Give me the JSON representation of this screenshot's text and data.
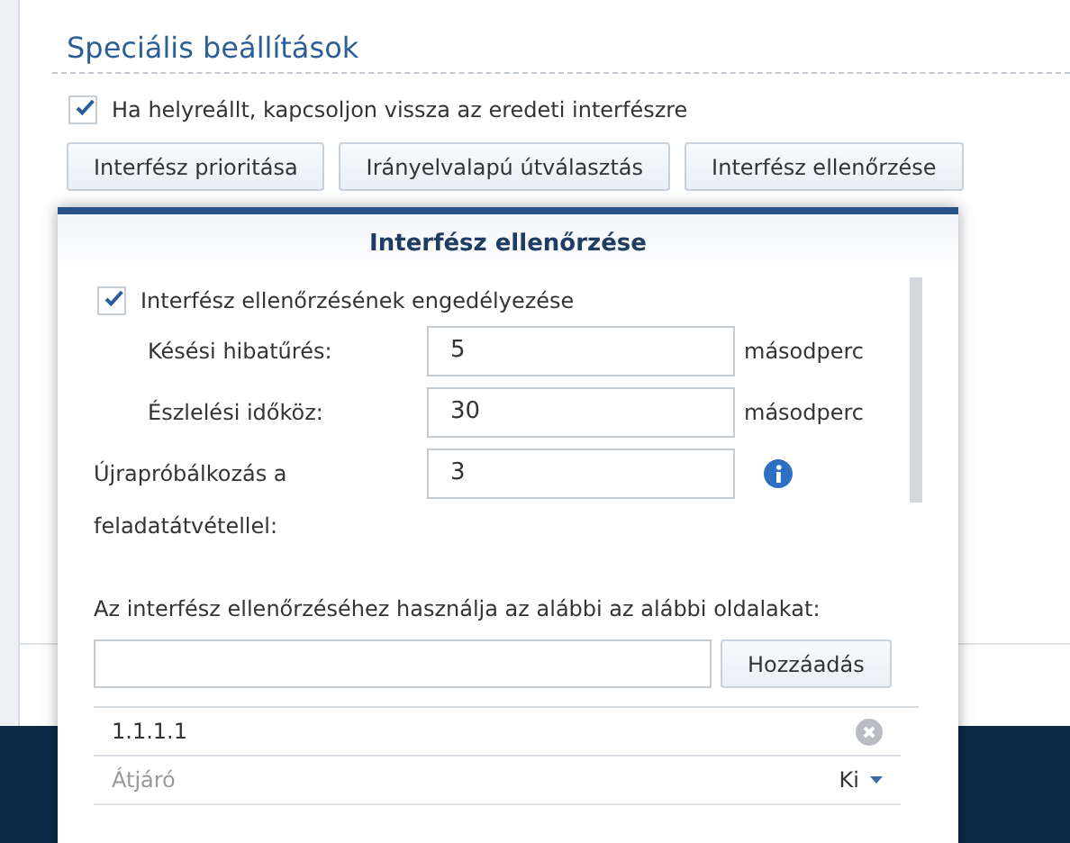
{
  "page": {
    "section_title": "Speciális beállítások",
    "revert_option": {
      "label": "Ha helyreállt, kapcsoljon vissza az eredeti interfészre",
      "checked": true
    },
    "buttons": [
      "Interfész prioritása",
      "Irányelvalapú útválasztás",
      "Interfész ellenőrzése"
    ]
  },
  "dialog": {
    "title": "Interfész ellenőrzése",
    "enable": {
      "label": "Interfész ellenőrzésének engedélyezése",
      "checked": true
    },
    "fields": [
      {
        "kind": "unit",
        "label": "Késési hibatűrés:",
        "value": "5",
        "unit": "másodperc"
      },
      {
        "kind": "unit",
        "label": "Észlelési időköz:",
        "value": "30",
        "unit": "másodperc"
      },
      {
        "kind": "info",
        "label": "Újrapróbálkozás a feladatátvétellel:",
        "value": "3"
      }
    ],
    "targets_hint": "Az interfész ellenőrzéséhez használja az alábbi az alábbi oldalakat:",
    "add_button": "Hozzáadás",
    "targets": [
      {
        "kind": "entry",
        "text": "1.1.1.1"
      },
      {
        "kind": "gateway",
        "label": "Átjáró",
        "value": "Ki"
      }
    ]
  }
}
